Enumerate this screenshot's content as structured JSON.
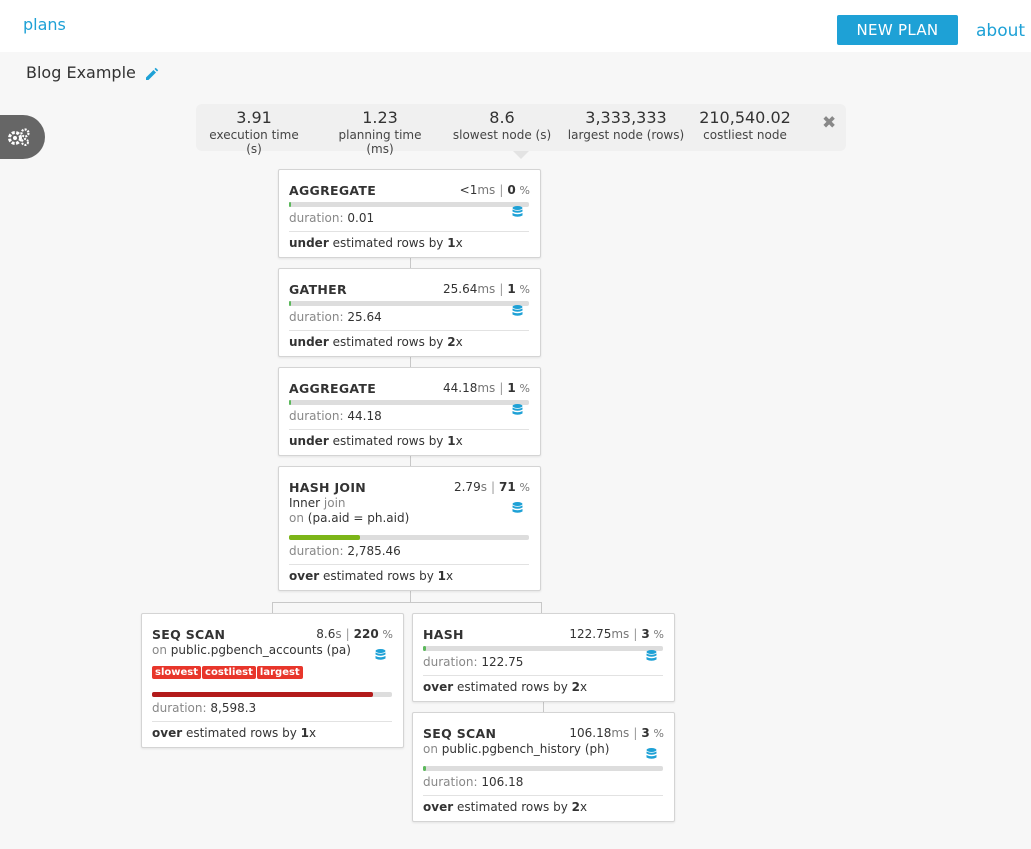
{
  "nav": {
    "plans": "plans",
    "new_plan": "NEW PLAN",
    "about": "about"
  },
  "plan_title": "Blog Example",
  "stats": [
    {
      "value": "3.91",
      "label": "execution time (s)"
    },
    {
      "value": "1.23",
      "label": "planning time (ms)"
    },
    {
      "value": "8.6",
      "label": "slowest node (s)"
    },
    {
      "value": "3,333,333",
      "label": "largest node (rows)"
    },
    {
      "value": "210,540.02",
      "label": "costliest node"
    }
  ],
  "nodes": [
    {
      "name": "AGGREGATE",
      "time": "<1",
      "unit": "ms",
      "pct": "0",
      "pct_sym": "%",
      "duration_label": "duration:",
      "duration": "0.01",
      "est_dir": "under",
      "est_text": "estimated rows by",
      "est_factor": "1",
      "est_x": "x",
      "bar_fraction": 0.005,
      "bar_color": "#5cb85c"
    },
    {
      "name": "GATHER",
      "time": "25.64",
      "unit": "ms",
      "pct": "1",
      "pct_sym": "%",
      "duration_label": "duration:",
      "duration": "25.64",
      "est_dir": "under",
      "est_text": "estimated rows by",
      "est_factor": "2",
      "est_x": "x",
      "bar_fraction": 0.006,
      "bar_color": "#5cb85c"
    },
    {
      "name": "AGGREGATE",
      "time": "44.18",
      "unit": "ms",
      "pct": "1",
      "pct_sym": "%",
      "duration_label": "duration:",
      "duration": "44.18",
      "est_dir": "under",
      "est_text": "estimated rows by",
      "est_factor": "1",
      "est_x": "x",
      "bar_fraction": 0.006,
      "bar_color": "#5cb85c"
    },
    {
      "name": "HASH JOIN",
      "time": "2.79",
      "unit": "s",
      "pct": "71",
      "pct_sym": "%",
      "join_type": "Inner",
      "join_word": "join",
      "on_word": "on",
      "condition": "(pa.aid = ph.aid)",
      "duration_label": "duration:",
      "duration": "2,785.46",
      "est_dir": "over",
      "est_text": "estimated rows by",
      "est_factor": "1",
      "est_x": "x",
      "bar_fraction": 0.295,
      "bar_color": "#7cb518"
    },
    {
      "name": "SEQ SCAN",
      "time": "8.6",
      "unit": "s",
      "pct": "220",
      "pct_sym": "%",
      "on_word": "on",
      "relation": "public.pgbench_accounts (pa)",
      "tags": [
        "slowest",
        "costliest",
        "largest"
      ],
      "duration_label": "duration:",
      "duration": "8,598.3",
      "est_dir": "over",
      "est_text": "estimated rows by",
      "est_factor": "1",
      "est_x": "x",
      "bar_fraction": 0.92,
      "bar_color": "#b31b1b"
    },
    {
      "name": "HASH",
      "time": "122.75",
      "unit": "ms",
      "pct": "3",
      "pct_sym": "%",
      "duration_label": "duration:",
      "duration": "122.75",
      "est_dir": "over",
      "est_text": "estimated rows by",
      "est_factor": "2",
      "est_x": "x",
      "bar_fraction": 0.012,
      "bar_color": "#5cb85c"
    },
    {
      "name": "SEQ SCAN",
      "time": "106.18",
      "unit": "ms",
      "pct": "3",
      "pct_sym": "%",
      "on_word": "on",
      "relation": "public.pgbench_history (ph)",
      "duration_label": "duration:",
      "duration": "106.18",
      "est_dir": "over",
      "est_text": "estimated rows by",
      "est_factor": "2",
      "est_x": "x",
      "bar_fraction": 0.012,
      "bar_color": "#5cb85c"
    }
  ],
  "icons": {
    "edit": "pencil-icon",
    "settings": "gears-icon",
    "close": "close-icon",
    "db": "database-icon"
  },
  "colors": {
    "accent": "#1ea1d6",
    "danger": "#e8362b"
  }
}
